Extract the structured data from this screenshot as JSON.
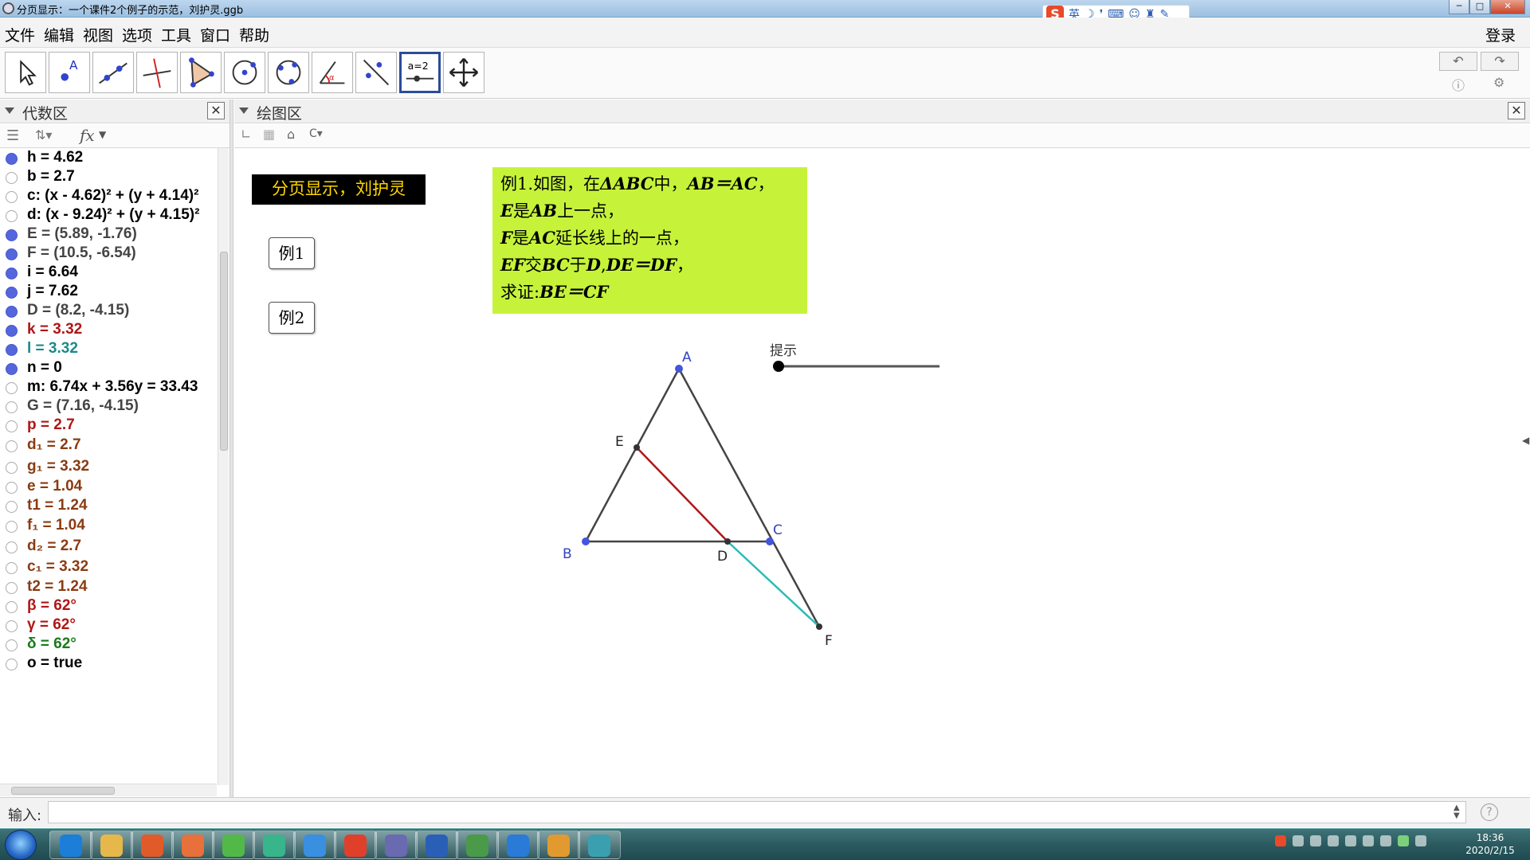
{
  "window": {
    "title": "分页显示：一个课件2个例子的示范，刘护灵.ggb"
  },
  "ime": {
    "logo": "S",
    "lang": "英"
  },
  "menu": {
    "items": [
      "文件",
      "编辑",
      "视图",
      "选项",
      "工具",
      "窗口",
      "帮助"
    ],
    "login": "登录"
  },
  "toolbar": {
    "tools": [
      "move-tool",
      "point-tool",
      "line-tool",
      "perpendicular-tool",
      "polygon-tool",
      "circle-tool",
      "conic-tool",
      "angle-tool",
      "reflect-tool",
      "slider-tool",
      "move-view-tool"
    ],
    "active": "slider-tool",
    "slider_icon_text": "a=2"
  },
  "algebra": {
    "title": "代数区",
    "fx_label": "fx",
    "items": [
      {
        "text": "h = 4.62",
        "color": "#000000",
        "visible": true
      },
      {
        "text": "b = 2.7",
        "color": "#000000",
        "visible": false
      },
      {
        "text": "c: (x - 4.62)² + (y + 4.14)²",
        "color": "#000000",
        "visible": false
      },
      {
        "text": "d: (x - 9.24)² + (y + 4.15)²",
        "color": "#000000",
        "visible": false
      },
      {
        "text": "E = (5.89, -1.76)",
        "color": "#444444",
        "visible": true
      },
      {
        "text": "F = (10.5, -6.54)",
        "color": "#444444",
        "visible": true
      },
      {
        "text": "i = 6.64",
        "color": "#000000",
        "visible": true
      },
      {
        "text": "j = 7.62",
        "color": "#000000",
        "visible": true
      },
      {
        "text": "D = (8.2, -4.15)",
        "color": "#444444",
        "visible": true
      },
      {
        "text": "k = 3.32",
        "color": "#b01616",
        "visible": true
      },
      {
        "text": "l = 3.32",
        "color": "#1a8a8a",
        "visible": true
      },
      {
        "text": "n = 0",
        "color": "#000000",
        "visible": true
      },
      {
        "text": "m: 6.74x + 3.56y = 33.43",
        "color": "#000000",
        "visible": false
      },
      {
        "text": "G = (7.16, -4.15)",
        "color": "#444444",
        "visible": false
      },
      {
        "text": "p = 2.7",
        "color": "#b01616",
        "visible": false
      },
      {
        "text": "d₁ = 2.7",
        "color": "#8a3b12",
        "visible": false
      },
      {
        "text": "g₁ = 3.32",
        "color": "#8a3b12",
        "visible": false
      },
      {
        "text": "e = 1.04",
        "color": "#8a3b12",
        "visible": false
      },
      {
        "text": "t1 = 1.24",
        "color": "#8a3b12",
        "visible": false
      },
      {
        "text": "f₁ = 1.04",
        "color": "#8a3b12",
        "visible": false
      },
      {
        "text": "d₂ = 2.7",
        "color": "#8a3b12",
        "visible": false
      },
      {
        "text": "c₁ = 3.32",
        "color": "#8a3b12",
        "visible": false
      },
      {
        "text": "t2 = 1.24",
        "color": "#8a3b12",
        "visible": false
      },
      {
        "text": "β = 62°",
        "color": "#b01616",
        "visible": false
      },
      {
        "text": "γ = 62°",
        "color": "#b01616",
        "visible": false
      },
      {
        "text": "δ = 62°",
        "color": "#1a7a1a",
        "visible": false
      },
      {
        "text": "o = true",
        "color": "#000000",
        "visible": false
      }
    ]
  },
  "graphics": {
    "title": "绘图区",
    "title_box": "分页显示，刘护灵",
    "example_buttons": [
      "例1",
      "例2"
    ],
    "problem_lines": [
      [
        "例1.如图，在",
        "ΔABC",
        "中，",
        "AB＝AC",
        "，"
      ],
      [
        "",
        "E",
        "是",
        "AB",
        "上一点，"
      ],
      [
        "",
        "F",
        "是",
        "AC",
        "延长线上的一点，"
      ],
      [
        "",
        "EF",
        "交",
        "BC",
        "于",
        "D",
        ",",
        "DE＝DF",
        "，"
      ],
      [
        "求证:",
        "BE＝CF",
        ""
      ]
    ],
    "problem_bg": "#c6f33a",
    "hint_label": "提示",
    "hint_slider_value": 0,
    "points": {
      "A": "A",
      "B": "B",
      "C": "C",
      "D": "D",
      "E": "E",
      "F": "F"
    },
    "segment_colors": {
      "ED": "#b01616",
      "DF": "#2bbcb5",
      "triangle": "#444444",
      "point": "#4455dd"
    }
  },
  "inputbar": {
    "label": "输入:",
    "value": "",
    "help": "?"
  },
  "taskbar": {
    "apps": [
      "ie-icon",
      "explorer-icon",
      "scissors-app-icon",
      "pdf-app-icon",
      "wechat-icon",
      "green-app-icon",
      "qq-browser-icon",
      "pdf-reader-icon",
      "geogebra-icon",
      "word-icon",
      "winrar-icon",
      "k-app-icon",
      "media-player-icon",
      "edu-app-icon"
    ],
    "time": "18:36",
    "date": "2020/2/15"
  }
}
